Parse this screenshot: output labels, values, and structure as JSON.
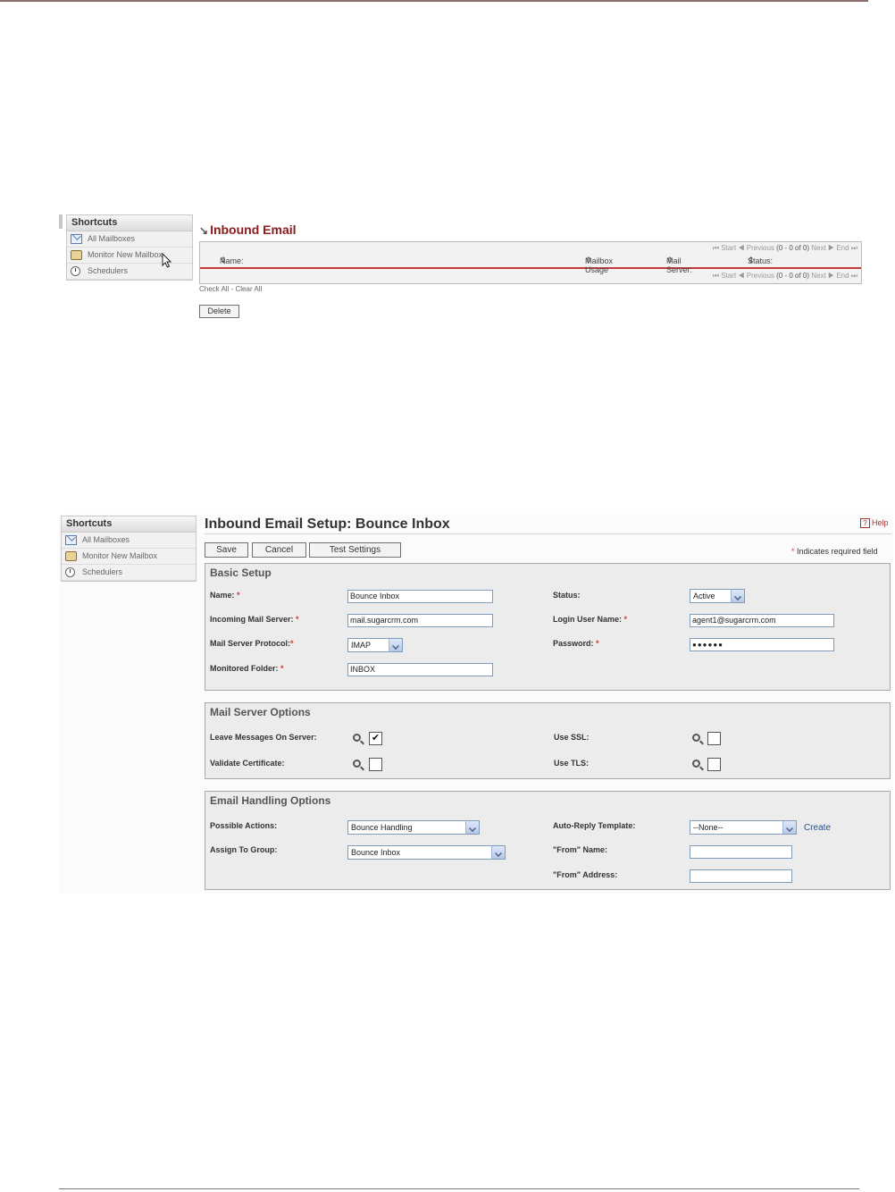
{
  "shortcuts": {
    "title": "Shortcuts",
    "items": [
      {
        "label": "All Mailboxes",
        "icon": "mail-icon"
      },
      {
        "label": "Monitor New Mailbox",
        "icon": "monitor-mailbox-icon"
      },
      {
        "label": "Schedulers",
        "icon": "clock-icon"
      }
    ]
  },
  "list_view": {
    "title": "Inbound Email",
    "pager": {
      "start": "Start",
      "previous": "Previous",
      "count": "(0 - 0 of 0)",
      "next": "Next",
      "end": "End"
    },
    "columns": [
      "Name:",
      "Mailbox Usage",
      "Mail Server:",
      "Status:"
    ],
    "check_all": "Check All",
    "separator": "-",
    "clear_all": "Clear All",
    "delete_label": "Delete"
  },
  "setup": {
    "title": "Inbound Email Setup: Bounce Inbox",
    "help_label": "Help",
    "save_label": "Save",
    "cancel_label": "Cancel",
    "test_label": "Test Settings",
    "required_note": "Indicates required field",
    "basic": {
      "title": "Basic Setup",
      "name_label": "Name:",
      "name_value": "Bounce Inbox",
      "server_label": "Incoming Mail Server:",
      "server_value": "mail.sugarcrm.com",
      "protocol_label": "Mail Server Protocol:",
      "protocol_value": "IMAP",
      "folder_label": "Monitored Folder:",
      "folder_value": "INBOX",
      "status_label": "Status:",
      "status_value": "Active",
      "login_label": "Login User Name:",
      "login_value": "agent1@sugarcrm.com",
      "password_label": "Password:",
      "password_value": "●●●●●●"
    },
    "mail_server": {
      "title": "Mail Server Options",
      "leave_label": "Leave Messages On Server:",
      "leave_checked": true,
      "validate_label": "Validate Certificate:",
      "validate_checked": false,
      "ssl_label": "Use SSL:",
      "ssl_checked": false,
      "tls_label": "Use TLS:",
      "tls_checked": false,
      "checkmark": "✔"
    },
    "email_handling": {
      "title": "Email Handling Options",
      "actions_label": "Possible Actions:",
      "actions_value": "Bounce Handling",
      "group_label": "Assign To Group:",
      "group_value": "Bounce Inbox",
      "template_label": "Auto-Reply Template:",
      "template_value": "--None--",
      "create_label": "Create",
      "from_name_label": "\"From\" Name:",
      "from_name_value": "",
      "from_address_label": "\"From\" Address:",
      "from_address_value": ""
    }
  }
}
